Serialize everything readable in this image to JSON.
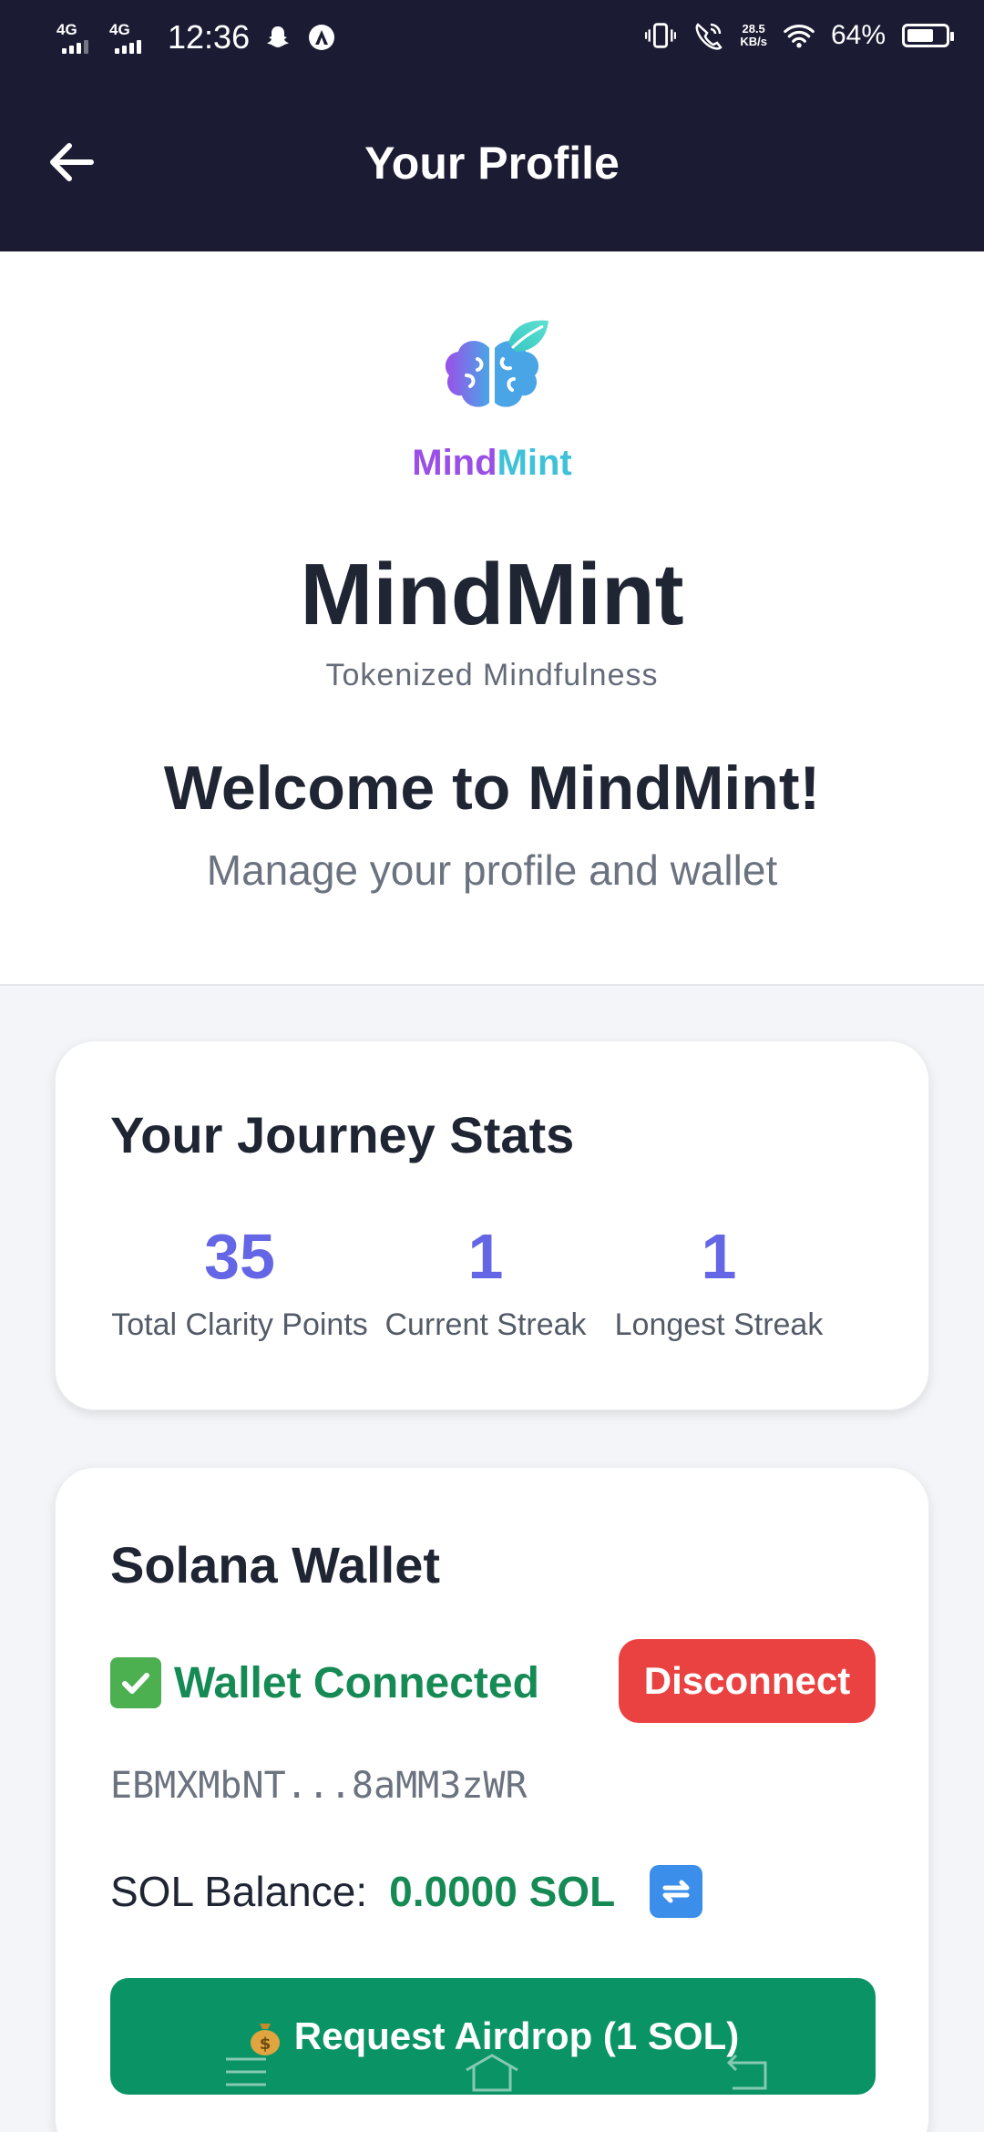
{
  "status_bar": {
    "network1": "4G",
    "network2": "4G",
    "time": "12:36",
    "speed_value": "28.5",
    "speed_unit": "KB/s",
    "battery": "64%"
  },
  "header": {
    "title": "Your Profile",
    "back_icon": "arrow-left-icon"
  },
  "logo": {
    "word_part1": "Mind",
    "word_part2": "Mint"
  },
  "hero": {
    "app_name": "MindMint",
    "tagline": "Tokenized Mindfulness",
    "welcome": "Welcome to MindMint!",
    "subtitle": "Manage your profile and wallet"
  },
  "stats": {
    "title": "Your Journey Stats",
    "items": [
      {
        "value": "35",
        "label": "Total Clarity Points"
      },
      {
        "value": "1",
        "label": "Current Streak"
      },
      {
        "value": "1",
        "label": "Longest Streak"
      }
    ]
  },
  "wallet": {
    "title": "Solana Wallet",
    "status": "Wallet Connected",
    "disconnect_label": "Disconnect",
    "address": "EBMXMbNT...8aMM3zWR",
    "balance_label": "SOL Balance:",
    "balance_value": "0.0000 SOL",
    "airdrop_label": "Request Airdrop (1 SOL)"
  },
  "colors": {
    "header_bg": "#1b1c33",
    "accent": "#6466e6",
    "success": "#168a55",
    "danger": "#ea4141",
    "airdrop_bg": "#0a9466"
  }
}
